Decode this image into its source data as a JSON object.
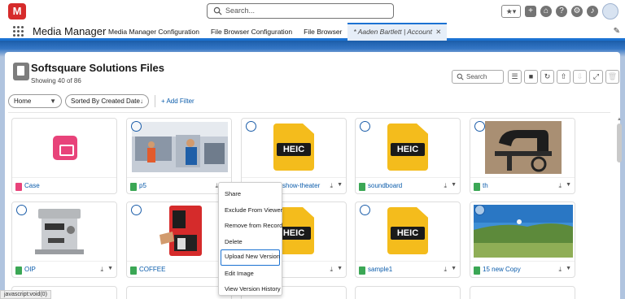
{
  "header": {
    "logo_text": "M",
    "search_placeholder": "Search...",
    "favorites_label": "★▾",
    "icons": [
      "favorites-icon",
      "add-icon",
      "trailhead-icon",
      "help-icon",
      "setup-gear-icon",
      "notifications-bell-icon",
      "avatar"
    ]
  },
  "nav": {
    "app_name": "Media Manager",
    "items": [
      {
        "label": "Media Manager Configuration"
      },
      {
        "label": "File Browser Configuration"
      },
      {
        "label": "File Browser"
      }
    ],
    "active_tab": {
      "label": "* Aaden Bartlett | Account",
      "close": "✕"
    }
  },
  "main": {
    "title": "Softsquare Solutions Files",
    "subtitle": "Showing 40 of 86",
    "search_placeholder": "Search",
    "filters": {
      "folder": "Home",
      "sort": "Sorted By Created Date",
      "add_filter": "+ Add Filter"
    }
  },
  "files": [
    {
      "name": "Case",
      "kind": "case"
    },
    {
      "name": "p5",
      "kind": "photo"
    },
    {
      "name": "show-theater",
      "kind": "heic",
      "heic_label": "HEIC"
    },
    {
      "name": "soundboard",
      "kind": "heic",
      "heic_label": "HEIC"
    },
    {
      "name": "th",
      "kind": "photo"
    },
    {
      "name": "OIP",
      "kind": "photo"
    },
    {
      "name": "COFFEE",
      "kind": "photo"
    },
    {
      "name": "",
      "kind": "heic",
      "heic_label": "HEIC"
    },
    {
      "name": "sample1",
      "kind": "heic",
      "heic_label": "HEIC"
    },
    {
      "name": "15 new Copy",
      "kind": "photo"
    }
  ],
  "context_menu": {
    "items": [
      "Share",
      "Exclude From Viewer",
      "Remove from Record",
      "Delete",
      "Upload New Version",
      "Edit Image",
      "View Version History"
    ],
    "highlighted": "Upload New Version"
  },
  "status_bar": "javascript:void(0)",
  "colors": {
    "brand": "#1b72d2",
    "link": "#0b5cab",
    "heic": "#f4bc1c",
    "case": "#e8437a",
    "logo": "#d62b2b"
  }
}
